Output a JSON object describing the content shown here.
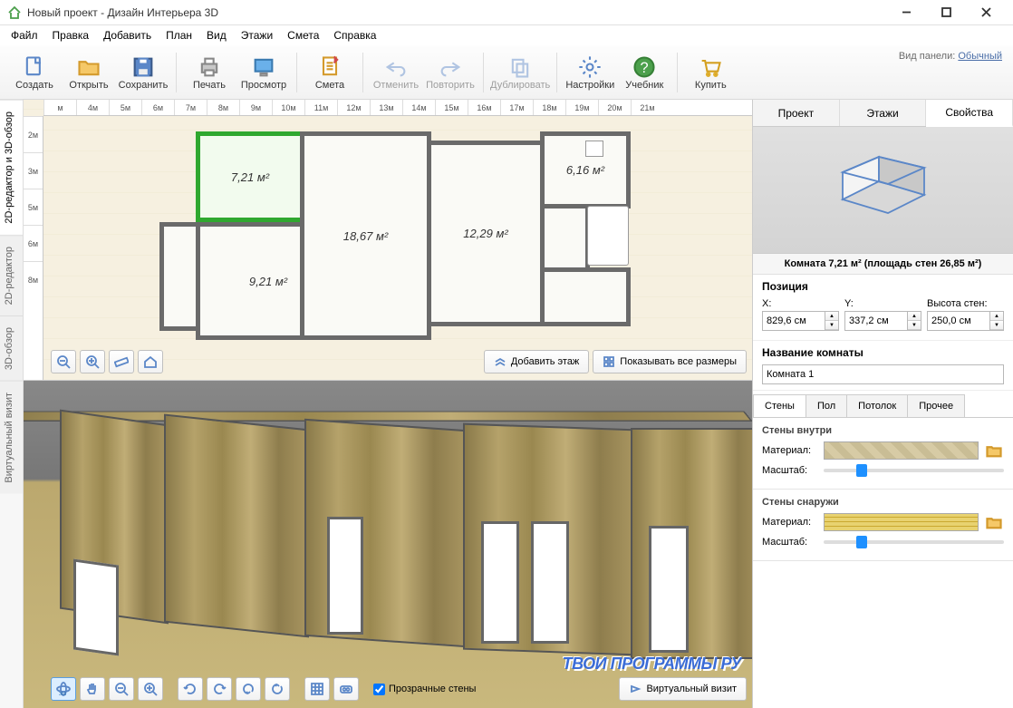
{
  "title": "Новый проект - Дизайн Интерьера 3D",
  "menu": [
    "Файл",
    "Правка",
    "Добавить",
    "План",
    "Вид",
    "Этажи",
    "Смета",
    "Справка"
  ],
  "toolbar": [
    {
      "label": "Создать",
      "icon": "doc"
    },
    {
      "label": "Открыть",
      "icon": "folder"
    },
    {
      "label": "Сохранить",
      "icon": "disk"
    },
    {
      "sep": true
    },
    {
      "label": "Печать",
      "icon": "printer"
    },
    {
      "label": "Просмотр",
      "icon": "monitor"
    },
    {
      "sep": true
    },
    {
      "label": "Смета",
      "icon": "clipboard"
    },
    {
      "sep": true
    },
    {
      "label": "Отменить",
      "icon": "undo",
      "disabled": true
    },
    {
      "label": "Повторить",
      "icon": "redo",
      "disabled": true
    },
    {
      "sep": true
    },
    {
      "label": "Дублировать",
      "icon": "dup",
      "disabled": true
    },
    {
      "sep": true
    },
    {
      "label": "Настройки",
      "icon": "gear"
    },
    {
      "label": "Учебник",
      "icon": "help"
    },
    {
      "sep": true
    },
    {
      "label": "Купить",
      "icon": "cart"
    }
  ],
  "viewpanel": {
    "label": "Вид панели:",
    "value": "Обычный"
  },
  "lefttabs": [
    "2D-редактор и 3D-обзор",
    "2D-редактор",
    "3D-обзор",
    "Виртуальный визит"
  ],
  "ruler_h": [
    "м",
    "4м",
    "5м",
    "6м",
    "7м",
    "8м",
    "9м",
    "10м",
    "11м",
    "12м",
    "13м",
    "14м",
    "15м",
    "16м",
    "17м",
    "18м",
    "19м",
    "20м",
    "21м"
  ],
  "ruler_v": [
    "2м",
    "3м",
    "5м",
    "6м",
    "8м"
  ],
  "rooms": {
    "r1": "7,21 м²",
    "r2": "18,67 м²",
    "r3": "12,29 м²",
    "r4": "6,16 м²",
    "r5": "9,21 м²"
  },
  "btn_add_floor": "Добавить этаж",
  "btn_show_dims": "Показывать все размеры",
  "chk_transparent": "Прозрачные стены",
  "btn_virtual": "Виртуальный визит",
  "watermark": "ТВОИ ПРОГРАММЫ РУ",
  "rtabs": [
    "Проект",
    "Этажи",
    "Свойства"
  ],
  "roominfo": "Комната 7,21 м²  (площадь стен 26,85 м²)",
  "props": {
    "position_title": "Позиция",
    "x_label": "X:",
    "y_label": "Y:",
    "h_label": "Высота стен:",
    "x": "829,6 см",
    "y": "337,2 см",
    "h": "250,0 см",
    "name_title": "Название комнаты",
    "name": "Комната 1"
  },
  "wtabs": [
    "Стены",
    "Пол",
    "Потолок",
    "Прочее"
  ],
  "walls": {
    "inside_title": "Стены внутри",
    "outside_title": "Стены снаружи",
    "material_label": "Материал:",
    "scale_label": "Масштаб:"
  }
}
